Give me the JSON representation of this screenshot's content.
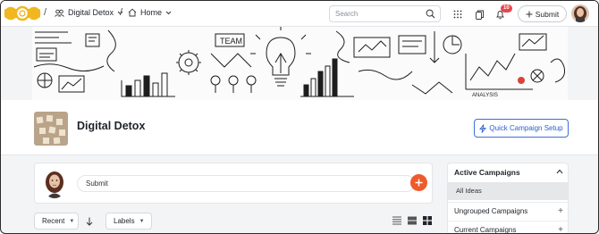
{
  "topnav": {
    "breadcrumb_sep": "/",
    "community_label": "Digital Detox",
    "home_label": "Home",
    "search_placeholder": "Search",
    "notification_count": "10",
    "submit_label": "Submit"
  },
  "header": {
    "title": "Digital Detox",
    "quick_setup_label": "Quick Campaign Setup"
  },
  "composer": {
    "input_value": "Submit"
  },
  "filters": {
    "sort_label": "Recent",
    "labels_label": "Labels"
  },
  "campaigns": {
    "title": "Active Campaigns",
    "all_ideas": "All Ideas",
    "items": [
      {
        "label": "Ungrouped Campaigns"
      },
      {
        "label": "Current Campaigns"
      }
    ]
  },
  "colors": {
    "accent": "#3b6fd8",
    "fab": "#ef5a2a",
    "badge": "#e5484d",
    "logo": "#f2b71f"
  },
  "icons": [
    "logo-rings-icon",
    "community-icon",
    "home-icon",
    "search-icon",
    "apps-grid-icon",
    "doc-icon",
    "bell-icon",
    "plus-icon",
    "bolt-icon",
    "sort-arrow-icon",
    "list-view-icon",
    "compact-view-icon",
    "grid-view-icon",
    "chevron-up-icon"
  ]
}
